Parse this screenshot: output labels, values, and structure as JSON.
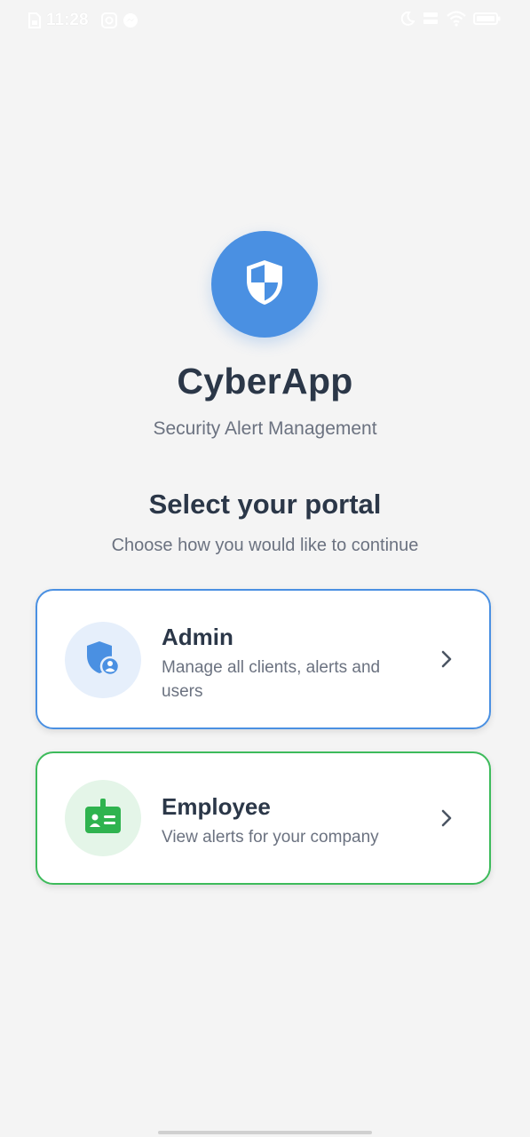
{
  "status_bar": {
    "time": "11:28",
    "icons_left": [
      "sim-card-icon",
      "instagram-icon",
      "messenger-icon"
    ],
    "icons_right": [
      "moon-icon",
      "network-speed-icon",
      "wifi-icon",
      "battery-icon"
    ]
  },
  "app": {
    "logo_icon": "shield-icon",
    "title": "CyberApp",
    "subtitle": "Security Alert Management"
  },
  "portal": {
    "title": "Select your portal",
    "subtitle": "Choose how you would like to continue"
  },
  "cards": {
    "admin": {
      "icon": "admin-shield-user-icon",
      "title": "Admin",
      "description": "Manage all clients, alerts and users",
      "accent_color": "#4a90e2"
    },
    "employee": {
      "icon": "id-badge-icon",
      "title": "Employee",
      "description": "View alerts for your company",
      "accent_color": "#3dbb5b"
    }
  }
}
